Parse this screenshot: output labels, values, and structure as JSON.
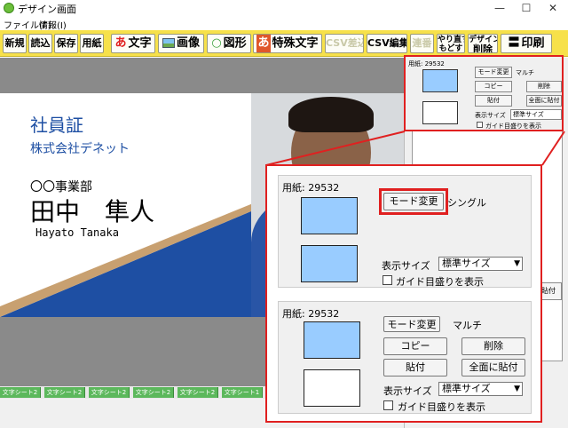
{
  "window": {
    "title": "デザイン画面",
    "minimize": "—",
    "maximize": "☐",
    "close": "✕"
  },
  "menu": {
    "file": "ファイル(F)",
    "info": "情報(I)"
  },
  "toolbar": {
    "new": "新規",
    "load": "読込",
    "save": "保存",
    "paper": "用紙",
    "text": "文字",
    "text_glyph": "あ",
    "image": "画像",
    "shape": "図形",
    "shape_glyph": "○",
    "special_text": "特殊文字",
    "special_glyph": "あ",
    "csv_merge": "CSV差込",
    "csv_edit": "CSV編集",
    "repeat": "連番",
    "undo_top": "やり直す",
    "undo_bottom": "もどす",
    "delete_top": "デザイン",
    "delete_bottom": "削除",
    "print_glyph": "〓",
    "print": "印刷"
  },
  "card": {
    "title": "社員証",
    "company": "株式会社デネット",
    "department": "〇〇事業部",
    "name": "田中　隼人",
    "romaji": "Hayato Tanaka"
  },
  "tabs": [
    "文字シート2",
    "文字シート2",
    "文字シート2",
    "文字シート2",
    "文字シート2",
    "文字シート1"
  ],
  "side_paste": "貼付",
  "inset": {
    "paper": "用紙: 29532",
    "mode_button": "モード変更",
    "mode": "マルチ",
    "copy": "コピー",
    "delete": "削除",
    "paste": "貼付",
    "paste_all": "全面に貼付",
    "size_label": "表示サイズ",
    "size_value": "標準サイズ",
    "guide": "ガイド目盛りを表示"
  },
  "single": {
    "paper": "用紙: 29532",
    "mode_button": "モード変更",
    "mode": "シングル",
    "size_label": "表示サイズ",
    "size_value": "標準サイズ",
    "guide": "ガイド目盛りを表示"
  },
  "multi": {
    "paper": "用紙: 29532",
    "mode_button": "モード変更",
    "mode": "マルチ",
    "copy": "コピー",
    "delete": "削除",
    "paste": "貼付",
    "paste_all": "全面に貼付",
    "size_label": "表示サイズ",
    "size_value": "標準サイズ",
    "guide": "ガイド目盛りを表示"
  },
  "colors": {
    "toolbar": "#f7e14a",
    "accent_red": "#e02020",
    "card_blue": "#1e4fa3",
    "swatch": "#99ccff"
  }
}
